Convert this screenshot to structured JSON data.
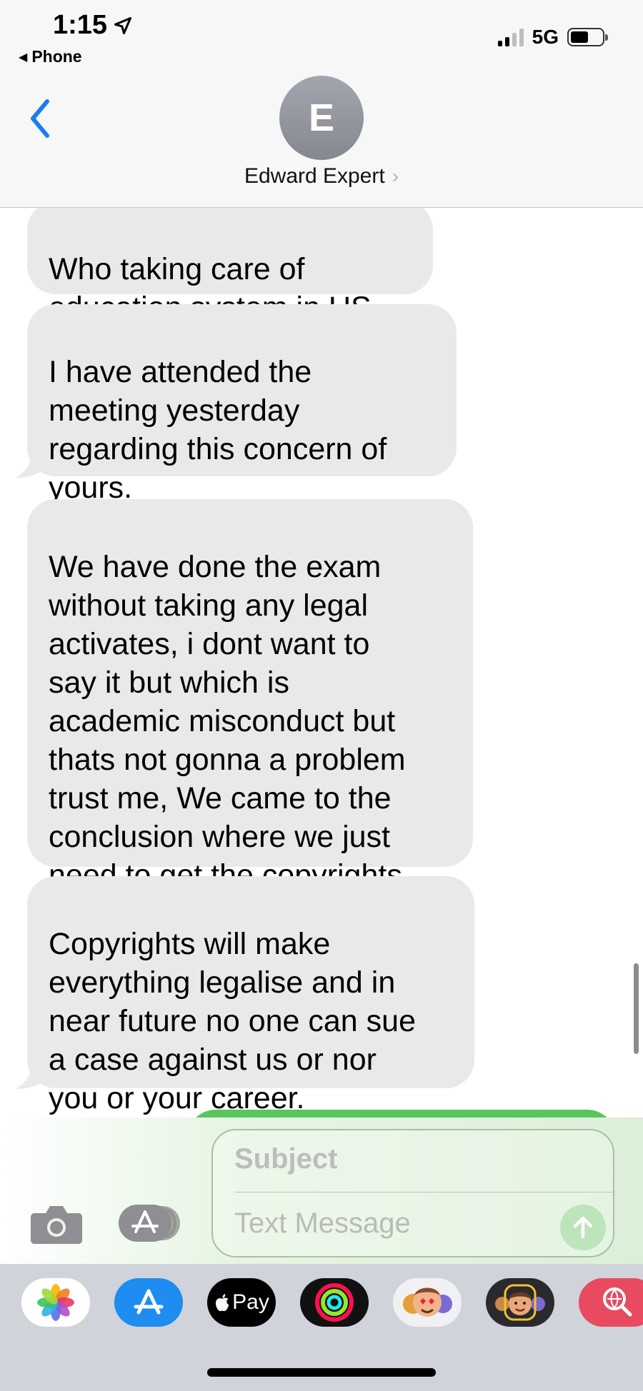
{
  "status_bar": {
    "time": "1:15",
    "back_app": "Phone",
    "network": "5G"
  },
  "header": {
    "avatar_initial": "E",
    "contact_name": "Edward Expert"
  },
  "messages": [
    {
      "direction": "received",
      "text": "Who taking care of\neducation system in US."
    },
    {
      "direction": "received",
      "text": "I have attended the\nmeeting yesterday\nregarding this concern of\nyours."
    },
    {
      "direction": "received",
      "text": "We have done the exam\nwithout taking any legal\nactivates, i dont want to\nsay it but which is\nacademic misconduct but\nthats not gonna a problem\ntrust me, We came to the\nconclusion where we just\nneed to get the copyrights"
    },
    {
      "direction": "received",
      "text": "Copyrights will make\neverything legalise and in\nnear future no one can sue\na case against us or nor\nyou or your career."
    }
  ],
  "compose": {
    "subject_placeholder": "Subject",
    "message_placeholder": "Text Message"
  },
  "app_drawer": {
    "apps": [
      "photos-icon",
      "app-store-icon",
      "apple-pay-icon",
      "fitness-icon",
      "animoji-icon",
      "memoji-icon",
      "images-search-icon"
    ],
    "apple_pay_label": "Pay"
  },
  "colors": {
    "received_bubble": "#e9e9eb",
    "sent_bubble": "#5ac45f",
    "accent_blue": "#1a7cf5"
  }
}
